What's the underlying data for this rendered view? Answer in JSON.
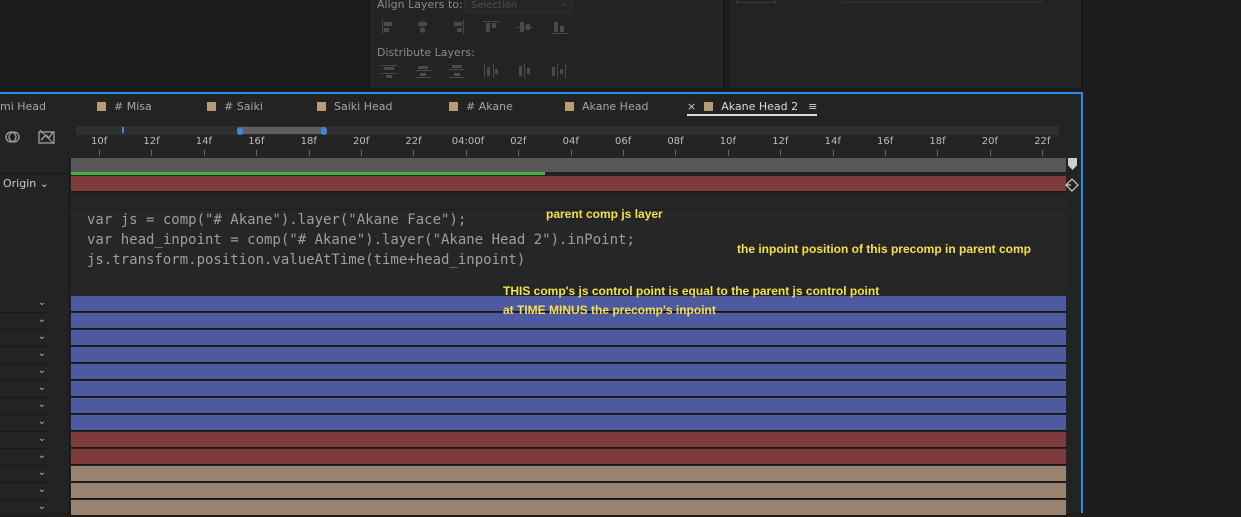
{
  "align_panel": {
    "align_label": "Align Layers to:",
    "align_select": "Selection",
    "distribute_label": "Distribute Layers:"
  },
  "tabs": [
    {
      "label": "mi Head",
      "swatch": false
    },
    {
      "label": "# Misa",
      "swatch": true
    },
    {
      "label": "# Saiki",
      "swatch": true
    },
    {
      "label": "Saiki Head",
      "swatch": true
    },
    {
      "label": "# Akane",
      "swatch": true
    },
    {
      "label": "Akane Head",
      "swatch": true
    },
    {
      "label": "Akane Head 2",
      "swatch": true,
      "active": true,
      "close": "×"
    }
  ],
  "menu_icon": "≡",
  "ruler": {
    "ticks": [
      "10f",
      "12f",
      "14f",
      "16f",
      "18f",
      "20f",
      "22f",
      "04:00f",
      "02f",
      "04f",
      "06f",
      "08f",
      "10f",
      "12f",
      "14f",
      "16f",
      "18f",
      "20f",
      "22f"
    ]
  },
  "layer_property": {
    "label": "Origin",
    "chevron": "⌄"
  },
  "expression": {
    "lines": [
      "var js = comp(\"# Akane\").layer(\"Akane Face\");",
      "var head_inpoint = comp(\"# Akane\").layer(\"Akane Head 2\").inPoint;",
      "js.transform.position.valueAtTime(time+head_inpoint)"
    ]
  },
  "annotations": {
    "parent_layer": "parent comp js layer",
    "inpoint": "the inpoint position of this precomp in parent comp",
    "explanation_line1": "THIS comp's js control point is equal to the parent js control point",
    "explanation_line2": "at TIME MINUS the precomp's inpoint"
  },
  "colors": {
    "accent": "#2d8ceb",
    "annotation": "#f4e04d",
    "layer_red": "#7e3b3b",
    "layer_blue": "#4e5aa0",
    "layer_tan": "#9a8370",
    "work_area_green": "#3fb43f"
  },
  "layer_bars": [
    "blue",
    "blue",
    "blue",
    "blue",
    "blue",
    "blue",
    "blue",
    "blue",
    "red",
    "red",
    "tan",
    "tan",
    "tan"
  ]
}
